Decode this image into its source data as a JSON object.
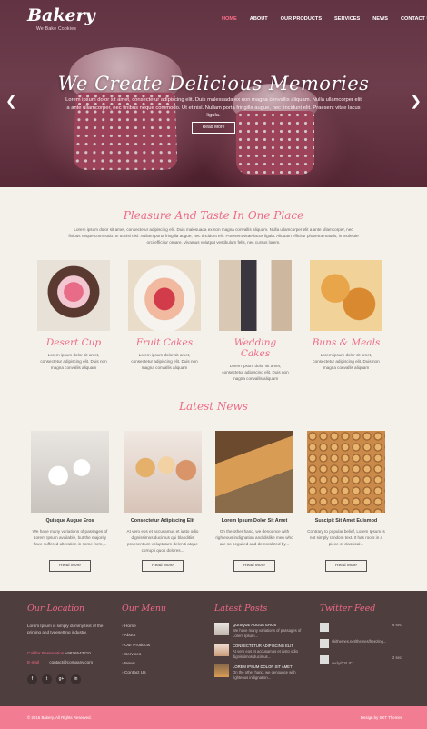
{
  "header": {
    "logo": "Bakery",
    "tagline": "We Bake Cookies",
    "nav": [
      "HOME",
      "ABOUT",
      "OUR PRODUCTS",
      "SERVICES",
      "NEWS",
      "CONTACT US"
    ]
  },
  "hero": {
    "title": "We Create Delicious Memories",
    "text": "Lorem ipsum dolor sit amet, consectetur adipiscing elit. Duis malesuada ex non magna convallis aliquam. Nulla ullamcorper elit a ante ullamcorper, nec finibus neque commodo. Ut et nisl. Nullam porta fringilla augue, nec tincidunt elit. Praesent vitae lacus ligula.",
    "button": "Read More",
    "prev_icon": "chevron-left-icon",
    "next_icon": "chevron-right-icon"
  },
  "features": {
    "title": "Pleasure And Taste In One Place",
    "intro": "Lorem ipsum dolor sit amet, consectetur adipiscing elit. Duis malesuada ex non magna convallis aliquam. Nulla ullamcorper elit a ante ullamcorper, nec finibus neque commodo. In ut nisl nisl. Nullam porta fringilla augue, nec tincidunt elit. Praesent vitae lacus ligula. Aliquam efficitur pharetra mauris, in molestie orci efficitur ornare. Vivamus volutpat vestibulum felis, nec cursus lorem.",
    "items": [
      {
        "name": "Desert Cup",
        "desc": "Lorem ipsum dolor sit amet, consectetur adipiscing elit. Duis non magna convallis aliquam"
      },
      {
        "name": "Fruit Cakes",
        "desc": "Lorem ipsum dolor sit amet, consectetur adipiscing elit. Duis non magna convallis aliquam"
      },
      {
        "name": "Wedding Cakes",
        "desc": "Lorem ipsum dolor sit amet, consectetur adipiscing elit. Duis non magna convallis aliquam"
      },
      {
        "name": "Buns & Meals",
        "desc": "Lorem ipsum dolor sit amet, consectetur adipiscing elit. Duis non magna convallis aliquam"
      }
    ]
  },
  "news": {
    "title": "Latest News",
    "button": "Read More",
    "items": [
      {
        "title": "Quisque Augue Eros",
        "text": "We have many variations of passages of Lorem Ipsum available, but the majority have suffered alteration in some form,..."
      },
      {
        "title": "Consectetur Adipiscing Elit",
        "text": "At vero eos et accusamus et iusto odio dignissimos ducimus qui blanditiis praesentium voluptatum deleniti atque corrupti quos dolores..."
      },
      {
        "title": "Lorem Ipsum Dolor Sit Amet",
        "text": "On the other hand, we denounce with righteous indignation and dislike men who are so beguiled and demoralized by..."
      },
      {
        "title": "Suscipit Sit Amet Euismod",
        "text": "Contrary to popular belief, Lorem Ipsum is not simply random text. It has roots in a piece of classical..."
      }
    ]
  },
  "footer": {
    "location": {
      "title": "Our Location",
      "text": "Lorem Ipsum is simply dummy text of the printing and typesetting industry.",
      "call_label": "Call for Reservation",
      "phone": "+9876543210",
      "email_label": "E-mail",
      "email": "contact@company.com",
      "socials": [
        "f",
        "t",
        "g+",
        "in"
      ]
    },
    "menu": {
      "title": "Our Menu",
      "items": [
        "Home",
        "About",
        "Our Products",
        "Services",
        "News",
        "Contact Us"
      ]
    },
    "posts": {
      "title": "Latest Posts",
      "items": [
        {
          "title": "QUISQUE AUGUE EROS",
          "text": "We have many variations of passages of Lorem Ipsum..."
        },
        {
          "title": "CONSECTETUR ADIPISCING ELIT",
          "text": "At vero eos et accusamus et iusto odio dignissimos ducimus..."
        },
        {
          "title": "LOREM IPSUM DOLOR SIT AMET",
          "text": "On the other hand, we denounce with righteous indignation..."
        }
      ]
    },
    "twitter": {
      "title": "Twitter Feed",
      "items": [
        {
          "text": "",
          "time": "6 sec"
        },
        {
          "text": "skithemes.net/themes/freezing...",
          "time": ""
        },
        {
          "text": "ow.ly/CYLtCr",
          "time": "2 sec"
        }
      ]
    },
    "copyright": "© 2016 Bakery. All Rights Reserved.",
    "designer": "Design by SKT Themes"
  },
  "colors": {
    "accent": "#ed6a86",
    "footer_bg": "#4e3e3e",
    "bar": "#f27d93"
  }
}
